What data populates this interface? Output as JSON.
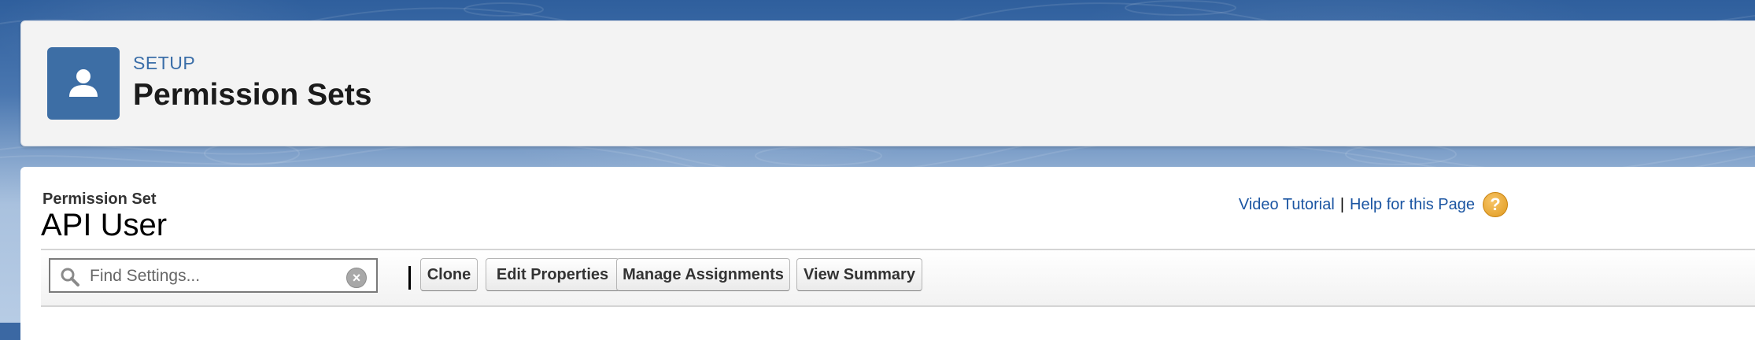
{
  "header": {
    "eyebrow": "SETUP",
    "title": "Permission Sets",
    "icon": "user-icon"
  },
  "record": {
    "type_label": "Permission Set",
    "name": "API User"
  },
  "help": {
    "video_tutorial": "Video Tutorial",
    "separator": "|",
    "help_page": "Help for this Page",
    "icon_glyph": "?"
  },
  "toolbar": {
    "search_placeholder": "Find Settings...",
    "clear_glyph": "×",
    "buttons": {
      "clone": "Clone",
      "edit_properties": "Edit Properties",
      "manage_assignments": "Manage Assignments",
      "view_summary": "View Summary"
    }
  },
  "colors": {
    "accent_blue": "#3d6ea5",
    "link_blue": "#1b55a2",
    "help_orange": "#e09a1e"
  }
}
